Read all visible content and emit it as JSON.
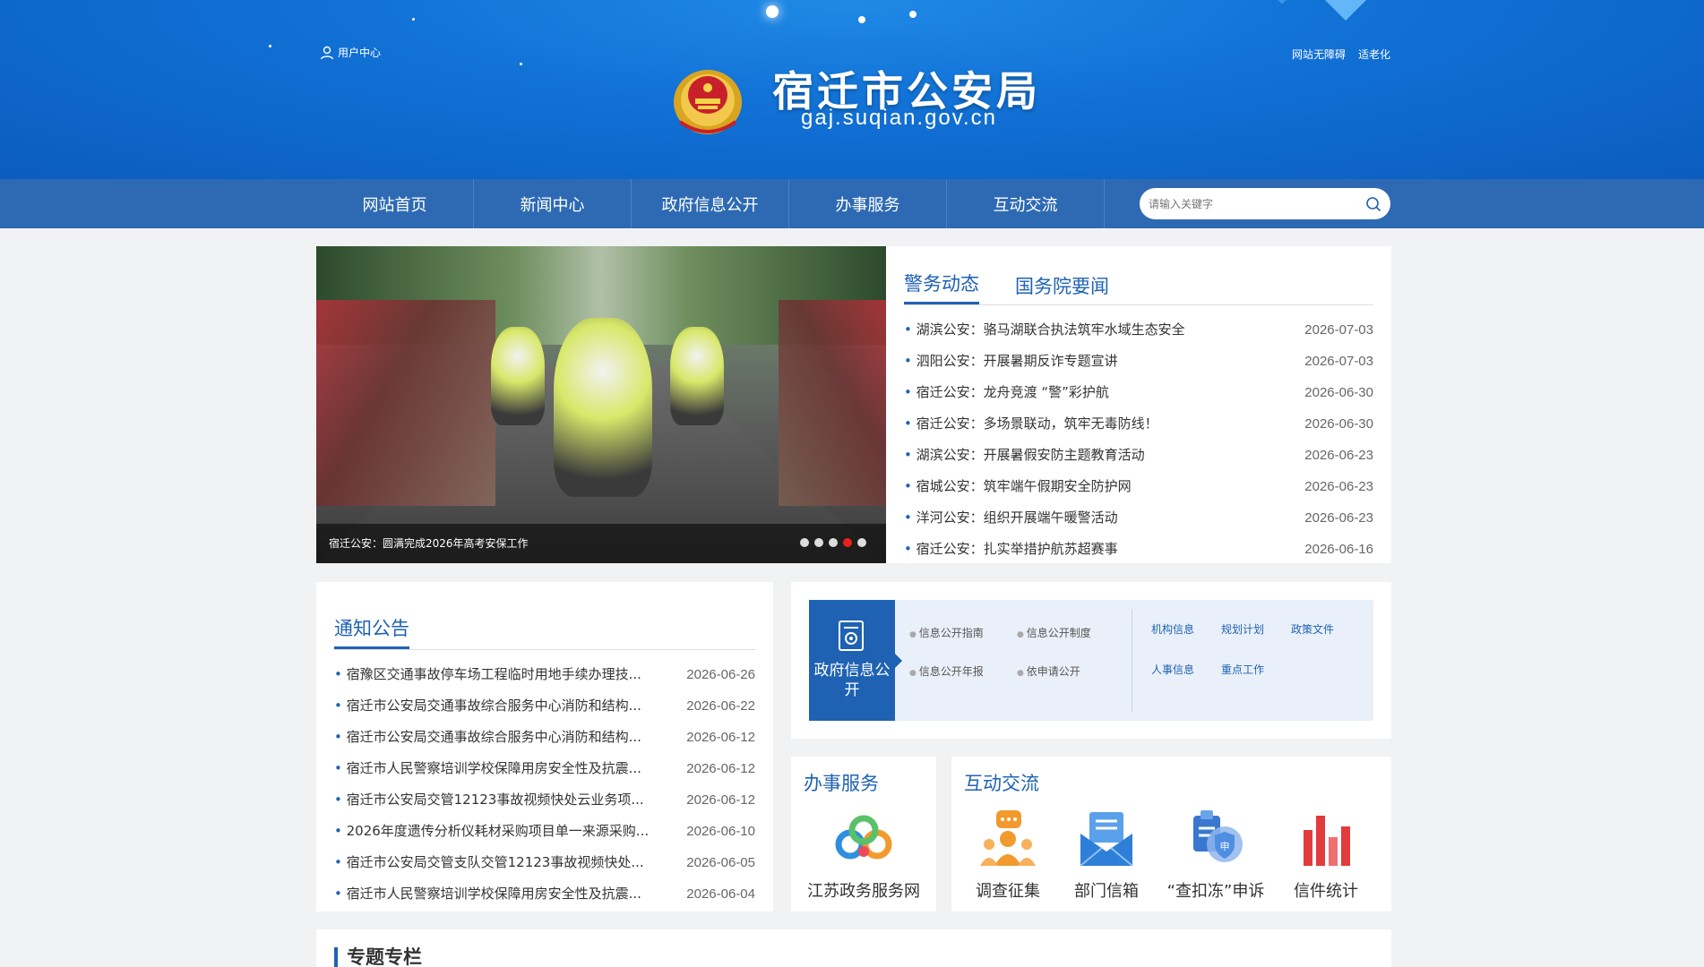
{
  "header": {
    "user_center": "用户中心",
    "site_title": "宿迁市公安局",
    "site_domain": "gaj.suqian.gov.cn",
    "accessibility": "网站无障碍",
    "elderly": "适老化"
  },
  "nav": {
    "items": [
      {
        "label": "网站首页"
      },
      {
        "label": "新闻中心"
      },
      {
        "label": "政府信息公开"
      },
      {
        "label": "办事服务"
      },
      {
        "label": "互动交流"
      }
    ],
    "search_placeholder": "请输入关键字"
  },
  "carousel": {
    "caption": "宿迁公安：圆满完成2026年高考安保工作",
    "slide_count": 5,
    "active_slide": 4
  },
  "news": {
    "tabs": [
      {
        "label": "警务动态"
      },
      {
        "label": "国务院要闻"
      }
    ],
    "items": [
      {
        "title": "湖滨公安：骆马湖联合执法筑牢水域生态安全",
        "date": "2026-07-03"
      },
      {
        "title": "泗阳公安：开展暑期反诈专题宣讲",
        "date": "2026-07-03"
      },
      {
        "title": "宿迁公安：龙舟竞渡 “警”彩护航",
        "date": "2026-06-30"
      },
      {
        "title": "宿迁公安：多场景联动，筑牢无毒防线！",
        "date": "2026-06-30"
      },
      {
        "title": "湖滨公安：开展暑假安防主题教育活动",
        "date": "2026-06-23"
      },
      {
        "title": "宿城公安：筑牢端午假期安全防护网",
        "date": "2026-06-23"
      },
      {
        "title": "洋河公安：组织开展端午暖警活动",
        "date": "2026-06-23"
      },
      {
        "title": "宿迁公安：扎实举措护航苏超赛事",
        "date": "2026-06-16"
      }
    ]
  },
  "notices": {
    "title": "通知公告",
    "items": [
      {
        "title": "宿豫区交通事故停车场工程临时用地手续办理技...",
        "date": "2026-06-26"
      },
      {
        "title": "宿迁市公安局交通事故综合服务中心消防和结构...",
        "date": "2026-06-22"
      },
      {
        "title": "宿迁市公安局交通事故综合服务中心消防和结构...",
        "date": "2026-06-12"
      },
      {
        "title": "宿迁市人民警察培训学校保障用房安全性及抗震...",
        "date": "2026-06-12"
      },
      {
        "title": "宿迁市公安局交管12123事故视频快处云业务项...",
        "date": "2026-06-12"
      },
      {
        "title": "2026年度遗传分析仪耗材采购项目单一来源采购...",
        "date": "2026-06-10"
      },
      {
        "title": "宿迁市公安局交管支队交管12123事故视频快处...",
        "date": "2026-06-05"
      },
      {
        "title": "宿迁市人民警察培训学校保障用房安全性及抗震...",
        "date": "2026-06-04"
      }
    ]
  },
  "govinfo": {
    "tile_label": "政府信息公开",
    "links_a": [
      "信息公开指南",
      "信息公开制度",
      "信息公开年报",
      "依申请公开"
    ],
    "links_b": [
      "机构信息",
      "规划计划",
      "政策文件",
      "人事信息",
      "重点工作"
    ]
  },
  "services": {
    "title": "办事服务",
    "items": [
      {
        "label": "江苏政务服务网",
        "icon": "jiangsu-service-logo-icon"
      }
    ]
  },
  "interact": {
    "title": "互动交流",
    "items": [
      {
        "label": "调查征集",
        "icon": "survey-people-icon"
      },
      {
        "label": "部门信箱",
        "icon": "mailbox-icon"
      },
      {
        "label": "“查扣冻”申诉",
        "icon": "appeal-shield-icon"
      },
      {
        "label": "信件统计",
        "icon": "bar-chart-icon"
      }
    ]
  },
  "special": {
    "title": "专题专栏"
  },
  "colors": {
    "primary": "#1f62b3",
    "nav_bg": "#2e6ab3",
    "header_bg": "#1272d6",
    "active_dot": "#e8201e"
  }
}
